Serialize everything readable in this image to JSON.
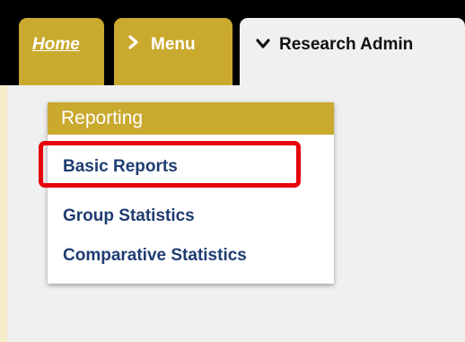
{
  "tabs": {
    "home": "Home",
    "menu": "Menu",
    "research": "Research Admin"
  },
  "icons": {
    "menu_icon": "chevron-right-icon",
    "research_icon": "chevron-down-icon"
  },
  "dropdown": {
    "header": "Reporting",
    "items": [
      {
        "label": "Basic Reports"
      },
      {
        "label": "Group Statistics"
      },
      {
        "label": "Comparative Statistics"
      }
    ]
  },
  "colors": {
    "tab_gold": "#c9a92e",
    "link_navy": "#1f3c71",
    "highlight_red": "#e8000b",
    "topbar_black": "#000000"
  }
}
